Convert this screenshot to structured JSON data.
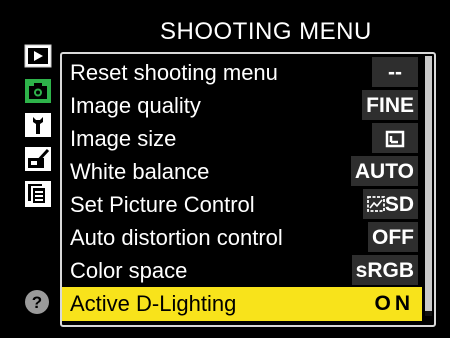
{
  "title": "SHOOTING MENU",
  "tabs": [
    {
      "name": "playback-menu-tab",
      "icon": "playback-icon",
      "active": false
    },
    {
      "name": "shooting-menu-tab",
      "icon": "camera-icon",
      "active": true
    },
    {
      "name": "setup-menu-tab",
      "icon": "wrench-icon",
      "active": false
    },
    {
      "name": "retouch-menu-tab",
      "icon": "retouch-brush-icon",
      "active": false
    },
    {
      "name": "recent-settings-tab",
      "icon": "recent-pages-icon",
      "active": false
    }
  ],
  "help": {
    "icon": "help-icon",
    "label": "?"
  },
  "menu": {
    "items": [
      {
        "label": "Reset shooting menu",
        "value": "--"
      },
      {
        "label": "Image quality",
        "value": "FINE"
      },
      {
        "label": "Image size",
        "value": "",
        "value_icon": "large-size-icon"
      },
      {
        "label": "White balance",
        "value": "AUTO"
      },
      {
        "label": "Set Picture Control",
        "value": "SD",
        "value_icon": "picture-control-icon"
      },
      {
        "label": "Auto distortion control",
        "value": "OFF"
      },
      {
        "label": "Color space",
        "value": "sRGB"
      },
      {
        "label": "Active D-Lighting",
        "value": "ON",
        "selected": true
      }
    ]
  },
  "colors": {
    "selection": "#f8e31b",
    "active_tab": "#2eb34a",
    "value_box": "#2e2e2e"
  }
}
